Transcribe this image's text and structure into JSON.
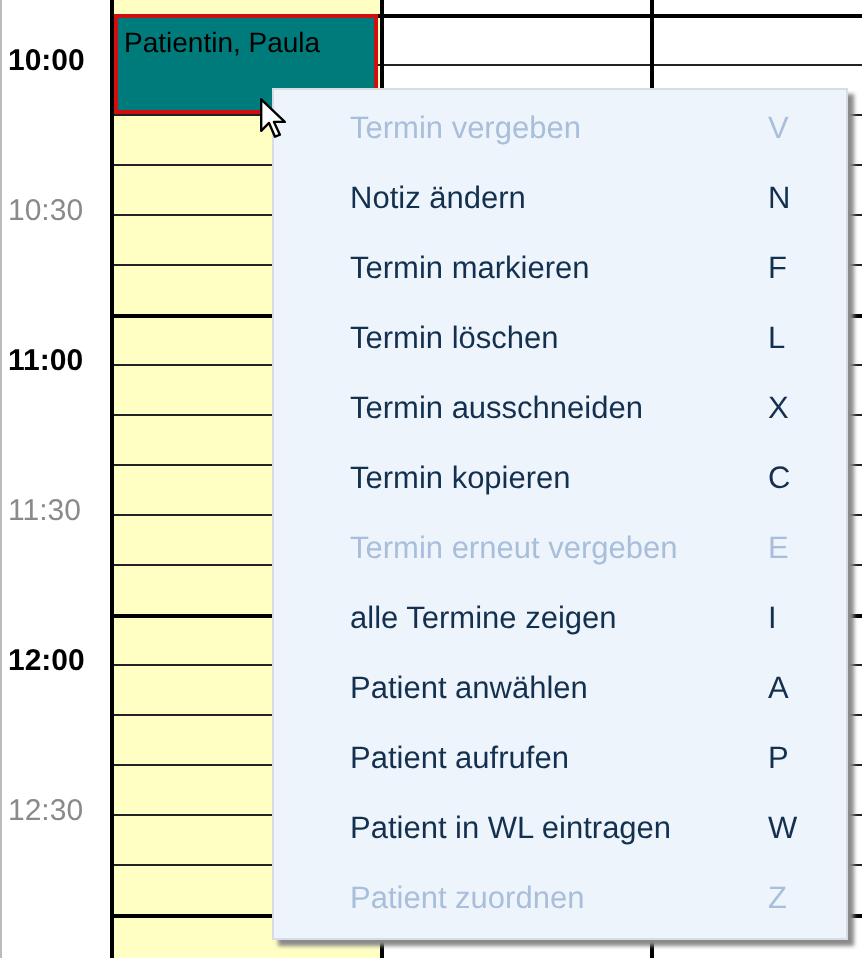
{
  "time_labels": [
    {
      "label": "10:00",
      "kind": "hour"
    },
    {
      "label": "10:30",
      "kind": "half"
    },
    {
      "label": "11:00",
      "kind": "hour"
    },
    {
      "label": "11:30",
      "kind": "half"
    },
    {
      "label": "12:00",
      "kind": "hour"
    },
    {
      "label": "12:30",
      "kind": "half"
    }
  ],
  "day_columns": [
    {
      "open": true,
      "appointment": {
        "text": "Patientin, Paula",
        "selected": true
      }
    },
    {
      "open": false
    },
    {
      "open": false
    }
  ],
  "context_menu": [
    {
      "label": "Termin vergeben",
      "shortcut": "V",
      "disabled": true
    },
    {
      "label": "Notiz ändern",
      "shortcut": "N",
      "disabled": false
    },
    {
      "label": "Termin markieren",
      "shortcut": "F",
      "disabled": false
    },
    {
      "label": "Termin löschen",
      "shortcut": "L",
      "disabled": false
    },
    {
      "label": "Termin ausschneiden",
      "shortcut": "X",
      "disabled": false
    },
    {
      "label": "Termin kopieren",
      "shortcut": "C",
      "disabled": false
    },
    {
      "label": "Termin erneut vergeben",
      "shortcut": "E",
      "disabled": true
    },
    {
      "label": "alle Termine zeigen",
      "shortcut": "I",
      "disabled": false
    },
    {
      "label": "Patient anwählen",
      "shortcut": "A",
      "disabled": false
    },
    {
      "label": "Patient aufrufen",
      "shortcut": "P",
      "disabled": false
    },
    {
      "label": "Patient in WL eintragen",
      "shortcut": "W",
      "disabled": false
    },
    {
      "label": "Patient zuordnen",
      "shortcut": "Z",
      "disabled": true
    }
  ]
}
